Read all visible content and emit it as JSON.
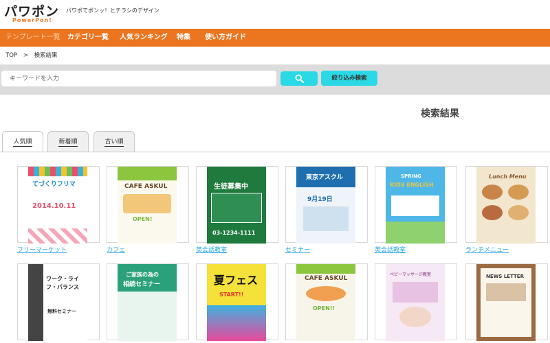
{
  "header": {
    "logo_main": "パワポン",
    "logo_sub": "PowerPon!",
    "tagline": "パワポでポンッ！とチラシのデザイン"
  },
  "nav": {
    "items": [
      "テンプレート一覧",
      "カテゴリ一覧",
      "人気ランキング",
      "特集",
      "使い方ガイド"
    ]
  },
  "breadcrumb": {
    "home": "TOP",
    "separator": ">",
    "current": "検索結果"
  },
  "search": {
    "placeholder": "キーワードを入力",
    "filter_label": "絞り込み検索",
    "search_icon": "search-icon"
  },
  "results": {
    "title": "検索結果",
    "tabs": [
      "人気順",
      "新着順",
      "古い順"
    ],
    "active_tab": "人気順"
  },
  "templates_row1": [
    {
      "label": "フリーマーケット",
      "thumb_title": "てづくりフリマ",
      "thumb_sub": "2014.10.11",
      "bg": "#ffffff",
      "accent": "#e94e6b"
    },
    {
      "label": "カフェ",
      "thumb_title": "CAFE ASKUL",
      "thumb_sub": "OPEN!",
      "bg": "#fbf8ee",
      "accent": "#7bb83a"
    },
    {
      "label": "英会話教室",
      "thumb_title": "生徒募集中",
      "thumb_sub": "03-1234-1111",
      "bg": "#1f7a3e",
      "accent": "#ffffff"
    },
    {
      "label": "セミナー",
      "thumb_title": "東京アスクル",
      "thumb_sub": "9月19日",
      "bg": "#1f6fb0",
      "accent": "#ffffff"
    },
    {
      "label": "英会話教室",
      "thumb_title": "KIDS ENGLISH",
      "thumb_sub": "SPRING",
      "bg": "#4fb7e8",
      "accent": "#f0c53c"
    },
    {
      "label": "ランチメニュー",
      "thumb_title": "Lunch Menu",
      "thumb_sub": "",
      "bg": "#f3e6cf",
      "accent": "#8a5a2b"
    }
  ],
  "templates_row2": [
    {
      "thumb_title": "ワーク・ライフ・バランス",
      "thumb_sub": "無料セミナー",
      "bg": "#ffffff",
      "accent": "#333333"
    },
    {
      "thumb_title": "ご家族の為の",
      "thumb_sub": "相続セミナー",
      "bg": "#2aa17a",
      "accent": "#ffffff"
    },
    {
      "thumb_title": "夏フェス",
      "thumb_sub": "START!!",
      "bg": "#f4e23a",
      "accent": "#111111"
    },
    {
      "thumb_title": "CAFE ASKUL",
      "thumb_sub": "OPEN!!",
      "bg": "#f7f5ea",
      "accent": "#6fb23a"
    },
    {
      "thumb_title": "ベビーマッサージ教室",
      "thumb_sub": "",
      "bg": "#f6e8f4",
      "accent": "#c98fc5"
    },
    {
      "thumb_title": "NEWS LETTER",
      "thumb_sub": "",
      "bg": "#9b6a42",
      "accent": "#ffffff"
    }
  ]
}
